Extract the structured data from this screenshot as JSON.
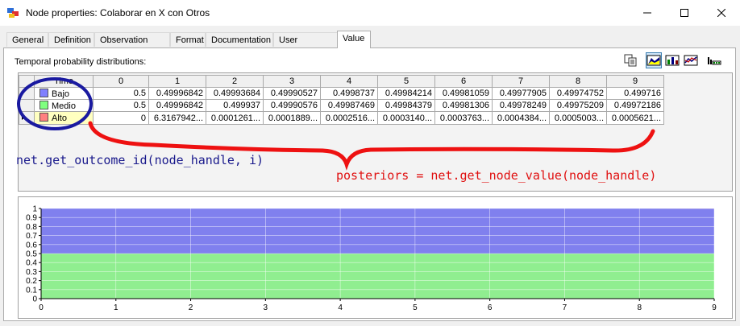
{
  "window": {
    "title": "Node properties: Colaborar en X con Otros"
  },
  "tabs": [
    {
      "label": "General",
      "active": false
    },
    {
      "label": "Definition",
      "active": false
    },
    {
      "label": "Observation Cost",
      "active": false
    },
    {
      "label": "Format",
      "active": false
    },
    {
      "label": "Documentation",
      "active": false
    },
    {
      "label": "User properties",
      "active": false
    },
    {
      "label": "Value",
      "active": true
    }
  ],
  "panel": {
    "label": "Temporal probability distributions:"
  },
  "toolbar": {
    "icons": [
      "copy-icon",
      "area-chart-icon",
      "chart-options-icon",
      "line-chart-icon",
      "bar-settings-icon"
    ]
  },
  "table": {
    "corner": "Time",
    "columns": [
      "0",
      "1",
      "2",
      "3",
      "4",
      "5",
      "6",
      "7",
      "8",
      "9"
    ],
    "rows": [
      {
        "label": "Bajo",
        "color": "#8080ff",
        "values": [
          "0.5",
          "0.49996842",
          "0.49993684",
          "0.49990527",
          "0.4998737",
          "0.49984214",
          "0.49981059",
          "0.49977905",
          "0.49974752",
          "0.499716"
        ]
      },
      {
        "label": "Medio",
        "color": "#80ff80",
        "values": [
          "0.5",
          "0.49996842",
          "0.499937",
          "0.49990576",
          "0.49987469",
          "0.49984379",
          "0.49981306",
          "0.49978249",
          "0.49975209",
          "0.49972186"
        ]
      },
      {
        "label": "Alto",
        "color": "#ff8080",
        "values": [
          "0",
          "6.3167942...",
          "0.0001261...",
          "0.0001889...",
          "0.0002516...",
          "0.0003140...",
          "0.0003763...",
          "0.0004384...",
          "0.0005003...",
          "0.0005621..."
        ]
      }
    ]
  },
  "annotations": {
    "left_code": "net.get_outcome_id(node_handle, i)",
    "right_code": "posteriors = net.get_node_value(node_handle)"
  },
  "chart_data": {
    "type": "area",
    "x": [
      0,
      1,
      2,
      3,
      4,
      5,
      6,
      7,
      8,
      9
    ],
    "series": [
      {
        "name": "Medio",
        "color": "#90ee90",
        "values": [
          0.5,
          0.49996842,
          0.499937,
          0.49990576,
          0.49987469,
          0.49984379,
          0.49981306,
          0.49978249,
          0.49975209,
          0.49972186
        ]
      },
      {
        "name": "Bajo",
        "color": "#8080ee",
        "values": [
          0.5,
          0.49996842,
          0.49993684,
          0.49990527,
          0.4998737,
          0.49984214,
          0.49981059,
          0.49977905,
          0.49974752,
          0.499716
        ]
      },
      {
        "name": "Alto",
        "color": "#ff8080",
        "values": [
          0,
          6.32e-05,
          0.000126,
          0.000189,
          0.000252,
          0.000314,
          0.000376,
          0.000438,
          0.0005,
          0.000562
        ]
      }
    ],
    "stacked": true,
    "xlim": [
      0,
      9
    ],
    "ylim": [
      0,
      1
    ],
    "xticks": [
      "0",
      "1",
      "2",
      "3",
      "4",
      "5",
      "6",
      "7",
      "8",
      "9"
    ],
    "yticks": [
      "0",
      "0.1",
      "0.2",
      "0.3",
      "0.4",
      "0.5",
      "0.6",
      "0.7",
      "0.8",
      "0.9",
      "1"
    ],
    "grid": true
  }
}
